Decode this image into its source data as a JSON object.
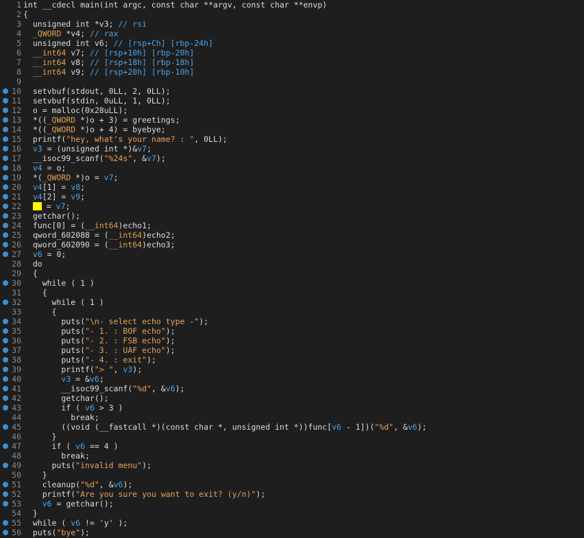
{
  "editor": {
    "lines": [
      {
        "n": "1",
        "bp": false,
        "t": [
          [
            "t",
            "int __cdecl main(int argc, const char **argv, const char **envp)"
          ]
        ]
      },
      {
        "n": "2",
        "bp": false,
        "t": [
          [
            "t",
            "{"
          ]
        ]
      },
      {
        "n": "3",
        "bp": false,
        "t": [
          [
            "t",
            "  unsigned int *v3; "
          ],
          [
            "va",
            "// rsi"
          ]
        ]
      },
      {
        "n": "4",
        "bp": false,
        "t": [
          [
            "t",
            "  "
          ],
          [
            "ty",
            "_QWORD"
          ],
          [
            "t",
            " *v4; "
          ],
          [
            "va",
            "// rax"
          ]
        ]
      },
      {
        "n": "5",
        "bp": false,
        "t": [
          [
            "t",
            "  unsigned int v6; "
          ],
          [
            "va",
            "// [rsp+Ch] [rbp-24h]"
          ]
        ]
      },
      {
        "n": "6",
        "bp": false,
        "t": [
          [
            "t",
            "  "
          ],
          [
            "ty",
            "__int64"
          ],
          [
            "t",
            " v7; "
          ],
          [
            "va",
            "// [rsp+10h] [rbp-20h]"
          ]
        ]
      },
      {
        "n": "7",
        "bp": false,
        "t": [
          [
            "t",
            "  "
          ],
          [
            "ty",
            "__int64"
          ],
          [
            "t",
            " v8; "
          ],
          [
            "va",
            "// [rsp+18h] [rbp-18h]"
          ]
        ]
      },
      {
        "n": "8",
        "bp": false,
        "t": [
          [
            "t",
            "  "
          ],
          [
            "ty",
            "__int64"
          ],
          [
            "t",
            " v9; "
          ],
          [
            "va",
            "// [rsp+20h] [rbp-10h]"
          ]
        ]
      },
      {
        "n": "9",
        "bp": false,
        "t": [
          [
            "t",
            ""
          ]
        ]
      },
      {
        "n": "10",
        "bp": true,
        "t": [
          [
            "t",
            "  setvbuf(stdout, 0LL, 2, 0LL);"
          ]
        ]
      },
      {
        "n": "11",
        "bp": true,
        "t": [
          [
            "t",
            "  setvbuf(stdin, 0uLL, 1, 0LL);"
          ]
        ]
      },
      {
        "n": "12",
        "bp": true,
        "t": [
          [
            "t",
            "  o = malloc(0x28uLL);"
          ]
        ]
      },
      {
        "n": "13",
        "bp": true,
        "t": [
          [
            "t",
            "  *(("
          ],
          [
            "ty",
            "_QWORD"
          ],
          [
            "t",
            " *)o + 3) = greetings;"
          ]
        ]
      },
      {
        "n": "14",
        "bp": true,
        "t": [
          [
            "t",
            "  *(("
          ],
          [
            "ty",
            "_QWORD"
          ],
          [
            "t",
            " *)o + 4) = byebye;"
          ]
        ]
      },
      {
        "n": "15",
        "bp": true,
        "t": [
          [
            "t",
            "  printf("
          ],
          [
            "st",
            "\"hey, what's your name? : \""
          ],
          [
            "t",
            ", 0LL);"
          ]
        ]
      },
      {
        "n": "16",
        "bp": true,
        "t": [
          [
            "t",
            "  "
          ],
          [
            "va",
            "v3"
          ],
          [
            "t",
            " = (unsigned int *)&"
          ],
          [
            "va",
            "v7"
          ],
          [
            "t",
            ";"
          ]
        ]
      },
      {
        "n": "17",
        "bp": true,
        "t": [
          [
            "t",
            "  __isoc99_scanf("
          ],
          [
            "st",
            "\"%24s\""
          ],
          [
            "t",
            ", &"
          ],
          [
            "va",
            "v7"
          ],
          [
            "t",
            ");"
          ]
        ]
      },
      {
        "n": "18",
        "bp": true,
        "t": [
          [
            "t",
            "  "
          ],
          [
            "va",
            "v4"
          ],
          [
            "t",
            " = o;"
          ]
        ]
      },
      {
        "n": "19",
        "bp": true,
        "t": [
          [
            "t",
            "  *("
          ],
          [
            "ty",
            "_QWORD"
          ],
          [
            "t",
            " *)o = "
          ],
          [
            "va",
            "v7"
          ],
          [
            "t",
            ";"
          ]
        ]
      },
      {
        "n": "20",
        "bp": true,
        "t": [
          [
            "t",
            "  "
          ],
          [
            "va",
            "v4"
          ],
          [
            "t",
            "[1] = "
          ],
          [
            "va",
            "v8"
          ],
          [
            "t",
            ";"
          ]
        ]
      },
      {
        "n": "21",
        "bp": true,
        "t": [
          [
            "t",
            "  "
          ],
          [
            "va",
            "v4"
          ],
          [
            "t",
            "[2] = "
          ],
          [
            "va",
            "v9"
          ],
          [
            "t",
            ";"
          ]
        ]
      },
      {
        "n": "22",
        "bp": true,
        "t": [
          [
            "t",
            "  "
          ],
          [
            "hl",
            ""
          ],
          [
            "t",
            " = "
          ],
          [
            "va",
            "v7"
          ],
          [
            "t",
            ";"
          ]
        ]
      },
      {
        "n": "23",
        "bp": true,
        "t": [
          [
            "t",
            "  getchar();"
          ]
        ]
      },
      {
        "n": "24",
        "bp": true,
        "t": [
          [
            "t",
            "  func[0] = ("
          ],
          [
            "ty",
            "__int64"
          ],
          [
            "t",
            ")echo1;"
          ]
        ]
      },
      {
        "n": "25",
        "bp": true,
        "t": [
          [
            "t",
            "  qword_602088 = ("
          ],
          [
            "ty",
            "__int64"
          ],
          [
            "t",
            ")echo2;"
          ]
        ]
      },
      {
        "n": "26",
        "bp": true,
        "t": [
          [
            "t",
            "  qword_602090 = ("
          ],
          [
            "ty",
            "__int64"
          ],
          [
            "t",
            ")echo3;"
          ]
        ]
      },
      {
        "n": "27",
        "bp": true,
        "t": [
          [
            "t",
            "  "
          ],
          [
            "va",
            "v6"
          ],
          [
            "t",
            " = 0;"
          ]
        ]
      },
      {
        "n": "28",
        "bp": false,
        "t": [
          [
            "t",
            "  do"
          ]
        ]
      },
      {
        "n": "29",
        "bp": false,
        "t": [
          [
            "t",
            "  {"
          ]
        ]
      },
      {
        "n": "30",
        "bp": true,
        "t": [
          [
            "t",
            "    while ( 1 )"
          ]
        ]
      },
      {
        "n": "31",
        "bp": false,
        "t": [
          [
            "t",
            "    {"
          ]
        ]
      },
      {
        "n": "32",
        "bp": true,
        "t": [
          [
            "t",
            "      while ( 1 )"
          ]
        ]
      },
      {
        "n": "33",
        "bp": false,
        "t": [
          [
            "t",
            "      {"
          ]
        ]
      },
      {
        "n": "34",
        "bp": true,
        "t": [
          [
            "t",
            "        puts("
          ],
          [
            "st",
            "\"\\n- select echo type -\""
          ],
          [
            "t",
            ");"
          ]
        ]
      },
      {
        "n": "35",
        "bp": true,
        "t": [
          [
            "t",
            "        puts("
          ],
          [
            "st",
            "\"- 1. : BOF echo\""
          ],
          [
            "t",
            ");"
          ]
        ]
      },
      {
        "n": "36",
        "bp": true,
        "t": [
          [
            "t",
            "        puts("
          ],
          [
            "st",
            "\"- 2. : FSB echo\""
          ],
          [
            "t",
            ");"
          ]
        ]
      },
      {
        "n": "37",
        "bp": true,
        "t": [
          [
            "t",
            "        puts("
          ],
          [
            "st",
            "\"- 3. : UAF echo\""
          ],
          [
            "t",
            ");"
          ]
        ]
      },
      {
        "n": "38",
        "bp": true,
        "t": [
          [
            "t",
            "        puts("
          ],
          [
            "st",
            "\"- 4. : exit\""
          ],
          [
            "t",
            ");"
          ]
        ]
      },
      {
        "n": "39",
        "bp": true,
        "t": [
          [
            "t",
            "        printf("
          ],
          [
            "st",
            "\"> \""
          ],
          [
            "t",
            ", "
          ],
          [
            "va",
            "v3"
          ],
          [
            "t",
            ");"
          ]
        ]
      },
      {
        "n": "40",
        "bp": true,
        "t": [
          [
            "t",
            "        "
          ],
          [
            "va",
            "v3"
          ],
          [
            "t",
            " = &"
          ],
          [
            "va",
            "v6"
          ],
          [
            "t",
            ";"
          ]
        ]
      },
      {
        "n": "41",
        "bp": true,
        "t": [
          [
            "t",
            "        __isoc99_scanf("
          ],
          [
            "st",
            "\"%d\""
          ],
          [
            "t",
            ", &"
          ],
          [
            "va",
            "v6"
          ],
          [
            "t",
            ");"
          ]
        ]
      },
      {
        "n": "42",
        "bp": true,
        "t": [
          [
            "t",
            "        getchar();"
          ]
        ]
      },
      {
        "n": "43",
        "bp": true,
        "t": [
          [
            "t",
            "        if ( "
          ],
          [
            "va",
            "v6"
          ],
          [
            "t",
            " > 3 )"
          ]
        ]
      },
      {
        "n": "44",
        "bp": false,
        "t": [
          [
            "t",
            "          break;"
          ]
        ]
      },
      {
        "n": "45",
        "bp": true,
        "t": [
          [
            "t",
            "        ((void (__fastcall *)(const char *, unsigned int *))func["
          ],
          [
            "va",
            "v6"
          ],
          [
            "t",
            " - 1])("
          ],
          [
            "st",
            "\"%d\""
          ],
          [
            "t",
            ", &"
          ],
          [
            "va",
            "v6"
          ],
          [
            "t",
            ");"
          ]
        ]
      },
      {
        "n": "46",
        "bp": false,
        "t": [
          [
            "t",
            "      }"
          ]
        ]
      },
      {
        "n": "47",
        "bp": true,
        "t": [
          [
            "t",
            "      if ( "
          ],
          [
            "va",
            "v6"
          ],
          [
            "t",
            " == 4 )"
          ]
        ]
      },
      {
        "n": "48",
        "bp": false,
        "t": [
          [
            "t",
            "        break;"
          ]
        ]
      },
      {
        "n": "49",
        "bp": true,
        "t": [
          [
            "t",
            "      puts("
          ],
          [
            "st",
            "\"invalid menu\""
          ],
          [
            "t",
            ");"
          ]
        ]
      },
      {
        "n": "50",
        "bp": false,
        "t": [
          [
            "t",
            "    }"
          ]
        ]
      },
      {
        "n": "51",
        "bp": true,
        "t": [
          [
            "t",
            "    cleanup("
          ],
          [
            "st",
            "\"%d\""
          ],
          [
            "t",
            ", &"
          ],
          [
            "va",
            "v6"
          ],
          [
            "t",
            ");"
          ]
        ]
      },
      {
        "n": "52",
        "bp": true,
        "t": [
          [
            "t",
            "    printf("
          ],
          [
            "st",
            "\"Are you sure you want to exit? (y/n)\""
          ],
          [
            "t",
            ");"
          ]
        ]
      },
      {
        "n": "53",
        "bp": true,
        "t": [
          [
            "t",
            "    "
          ],
          [
            "va",
            "v6"
          ],
          [
            "t",
            " = getchar();"
          ]
        ]
      },
      {
        "n": "54",
        "bp": false,
        "t": [
          [
            "t",
            "  }"
          ]
        ]
      },
      {
        "n": "55",
        "bp": true,
        "t": [
          [
            "t",
            "  while ( "
          ],
          [
            "va",
            "v6"
          ],
          [
            "t",
            " != 'y' );"
          ]
        ]
      },
      {
        "n": "56",
        "bp": true,
        "t": [
          [
            "t",
            "  puts("
          ],
          [
            "st",
            "\"bye\""
          ],
          [
            "t",
            ");"
          ]
        ]
      }
    ]
  },
  "colors": {
    "background": "#1e1e1e",
    "text": "#dcdcdc",
    "type": "#e0a050",
    "string": "#e8a15c",
    "variable": "#4aa3e8",
    "breakpoint": "#3d8fd1",
    "line_number": "#8a8a8a",
    "highlight": "#ffff00"
  }
}
